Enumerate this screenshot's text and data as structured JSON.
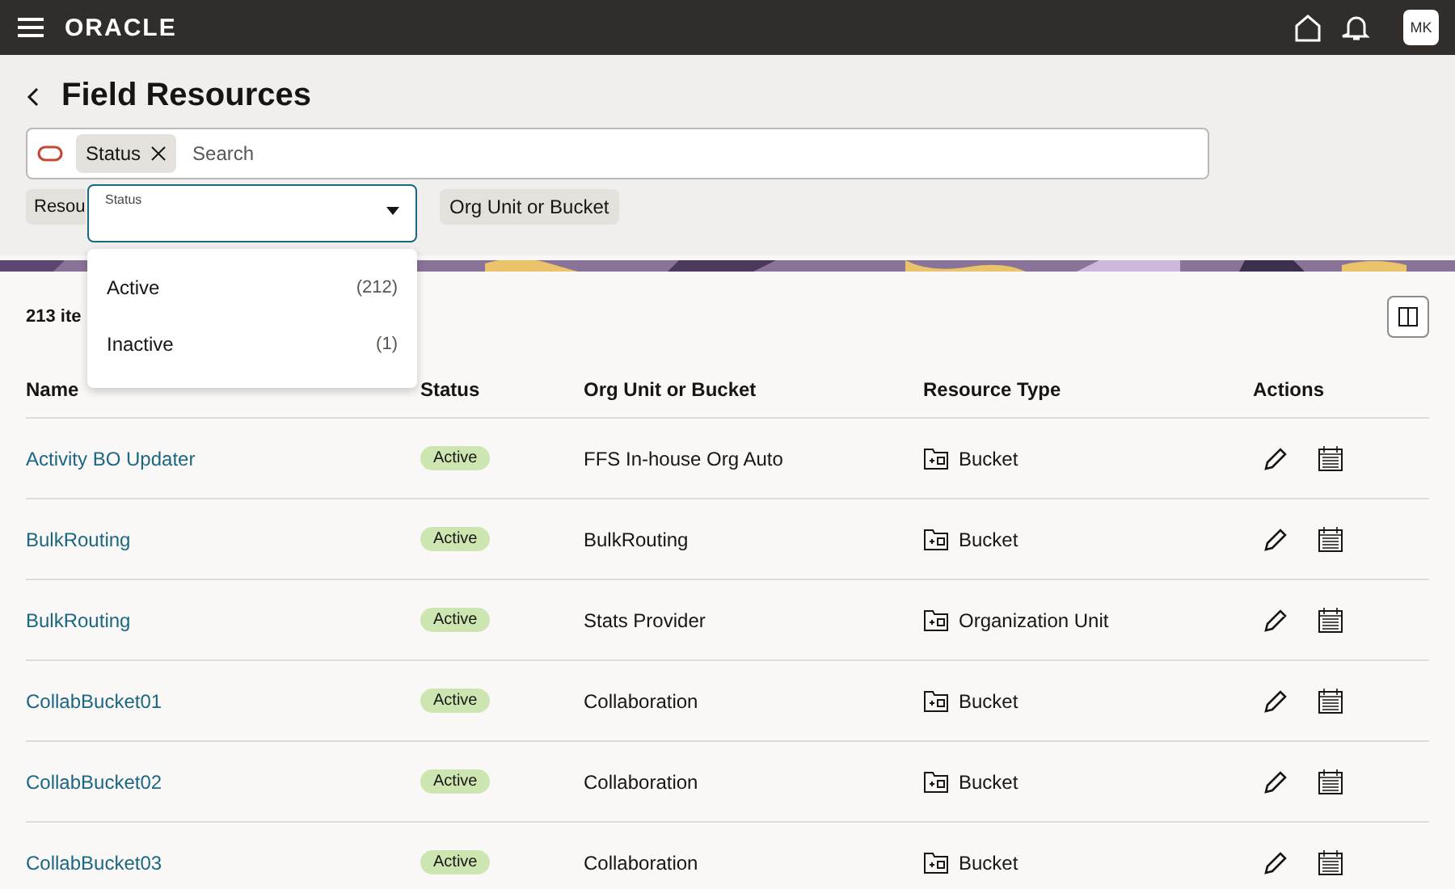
{
  "header": {
    "brand": "ORACLE",
    "avatar": "MK"
  },
  "page": {
    "title": "Field Resources"
  },
  "search": {
    "chip": "Status",
    "placeholder": "Search"
  },
  "filters": [
    "Resou",
    "Org Unit or Bucket"
  ],
  "dropdown": {
    "label": "Status",
    "options": [
      {
        "label": "Active",
        "count": "(212)"
      },
      {
        "label": "Inactive",
        "count": "(1)"
      }
    ]
  },
  "count": "213 ite",
  "table": {
    "columns": [
      "Name",
      "Status",
      "Org Unit or Bucket",
      "Resource Type",
      "Actions"
    ],
    "rows": [
      {
        "name": "Activity BO Updater",
        "status": "Active",
        "org": "FFS In-house Org Auto",
        "type": "Bucket"
      },
      {
        "name": "BulkRouting",
        "status": "Active",
        "org": "BulkRouting",
        "type": "Bucket"
      },
      {
        "name": "BulkRouting",
        "status": "Active",
        "org": "Stats Provider",
        "type": "Organization Unit"
      },
      {
        "name": "CollabBucket01",
        "status": "Active",
        "org": "Collaboration",
        "type": "Bucket"
      },
      {
        "name": "CollabBucket02",
        "status": "Active",
        "org": "Collaboration",
        "type": "Bucket"
      },
      {
        "name": "CollabBucket03",
        "status": "Active",
        "org": "Collaboration",
        "type": "Bucket"
      }
    ]
  }
}
